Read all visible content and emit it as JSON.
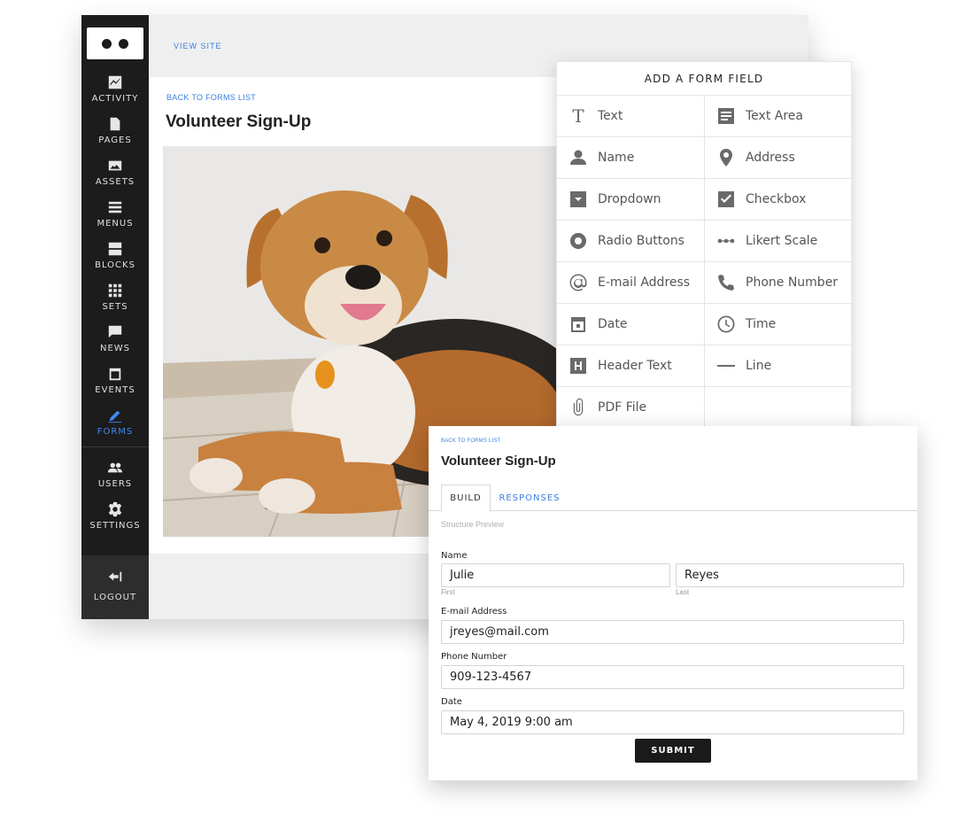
{
  "sidebar": {
    "items": [
      {
        "label": "ACTIVITY",
        "icon": "activity-icon"
      },
      {
        "label": "PAGES",
        "icon": "page-icon"
      },
      {
        "label": "ASSETS",
        "icon": "image-icon"
      },
      {
        "label": "MENUS",
        "icon": "menu-icon"
      },
      {
        "label": "BLOCKS",
        "icon": "blocks-icon"
      },
      {
        "label": "SETS",
        "icon": "grid-icon"
      },
      {
        "label": "NEWS",
        "icon": "chat-icon"
      },
      {
        "label": "EVENTS",
        "icon": "calendar-icon"
      },
      {
        "label": "FORMS",
        "icon": "pencil-icon",
        "active": true
      },
      {
        "label": "USERS",
        "icon": "users-icon"
      },
      {
        "label": "SETTINGS",
        "icon": "gear-icon"
      }
    ],
    "logout_label": "LOGOUT",
    "active_color": "#3d8bf2"
  },
  "topbar": {
    "view_site": "VIEW SITE"
  },
  "page": {
    "back_link": "BACK TO FORMS LIST",
    "title": "Volunteer Sign-Up"
  },
  "fields_panel": {
    "title": "ADD A FORM FIELD",
    "fields": [
      {
        "label": "Text",
        "icon": "text-icon"
      },
      {
        "label": "Text Area",
        "icon": "text-area-icon"
      },
      {
        "label": "Name",
        "icon": "person-icon"
      },
      {
        "label": "Address",
        "icon": "map-pin-icon"
      },
      {
        "label": "Dropdown",
        "icon": "dropdown-icon"
      },
      {
        "label": "Checkbox",
        "icon": "checkbox-icon"
      },
      {
        "label": "Radio Buttons",
        "icon": "radio-icon"
      },
      {
        "label": "Likert Scale",
        "icon": "likert-icon"
      },
      {
        "label": "E-mail Address",
        "icon": "at-sign-icon"
      },
      {
        "label": "Phone Number",
        "icon": "phone-icon"
      },
      {
        "label": "Date",
        "icon": "calendar-icon"
      },
      {
        "label": "Time",
        "icon": "clock-icon"
      },
      {
        "label": "Header Text",
        "icon": "header-icon"
      },
      {
        "label": "Line",
        "icon": "line-icon"
      },
      {
        "label": "PDF File",
        "icon": "paperclip-icon"
      },
      {
        "label": "",
        "icon": ""
      }
    ]
  },
  "form_preview": {
    "back_link": "BACK TO FORMS LIST",
    "title": "Volunteer Sign-Up",
    "tabs": {
      "build": "BUILD",
      "responses": "RESPONSES"
    },
    "structure_preview": "Structure Preview",
    "name_label": "Name",
    "first_value": "Julie",
    "first_sub": "First",
    "last_value": "Reyes",
    "last_sub": "Last",
    "email_label": "E-mail Address",
    "email_value": "jreyes@mail.com",
    "phone_label": "Phone Number",
    "phone_value": "909-123-4567",
    "date_label": "Date",
    "date_value": "May 4, 2019 9:00 am",
    "submit": "SUBMIT"
  }
}
